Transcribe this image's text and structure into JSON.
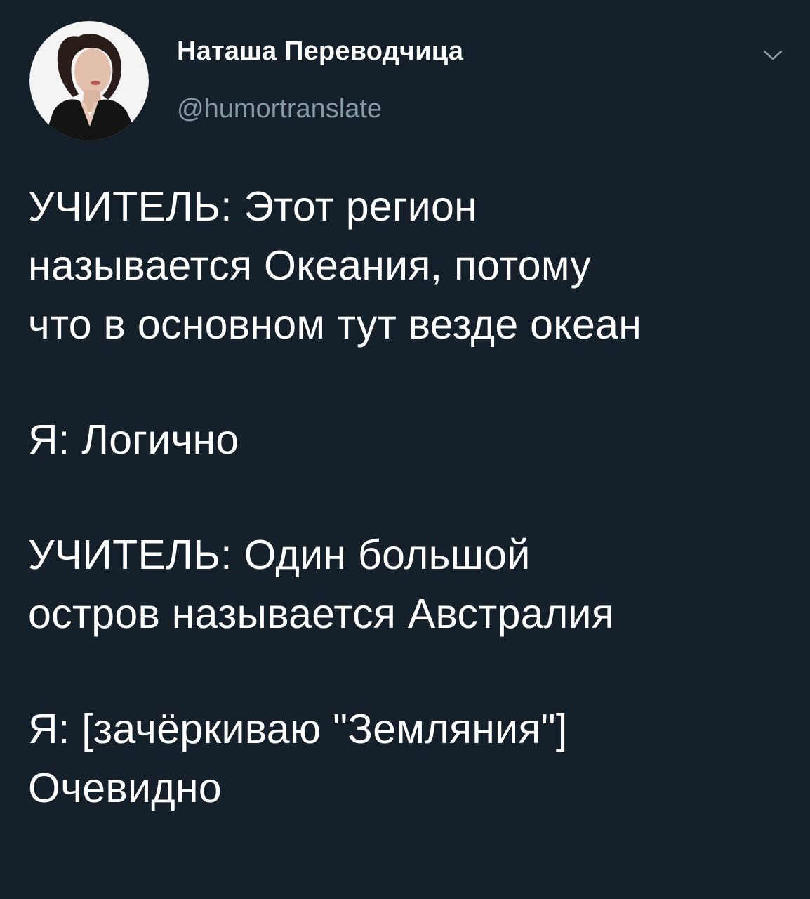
{
  "author": {
    "name": "Наташа Переводчица",
    "handle": "@humortranslate",
    "avatar_icon": "user-avatar"
  },
  "menu": {
    "icon": "chevron-down-icon"
  },
  "tweet": {
    "paragraphs": [
      {
        "lines": [
          "УЧИТЕЛЬ: Этот регион",
          "называется Океания, потому",
          "что в основном тут везде океан"
        ]
      },
      {
        "lines": [
          "Я: Логично"
        ]
      },
      {
        "lines": [
          "УЧИТЕЛЬ: Один большой",
          "остров называется Австралия"
        ]
      },
      {
        "lines": [
          "Я: [зачёркиваю \"Землянияʺ]",
          "Очевидно"
        ]
      }
    ]
  },
  "colors": {
    "background": "#15202b",
    "text": "#ffffff",
    "secondary_text": "#8899a6"
  }
}
